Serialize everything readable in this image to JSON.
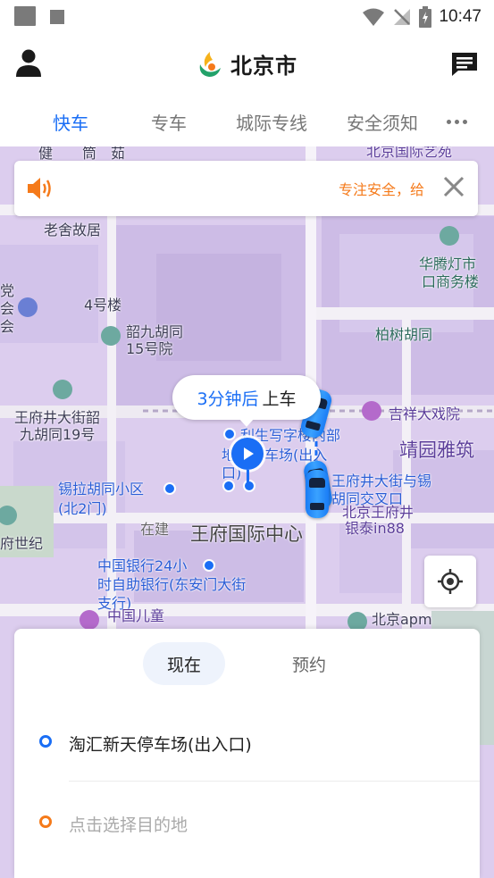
{
  "status_bar": {
    "time": "10:47"
  },
  "header": {
    "city": "北京市"
  },
  "tabs": [
    {
      "label": "快车",
      "active": true
    },
    {
      "label": "专车"
    },
    {
      "label": "城际专线"
    },
    {
      "label": "安全须知"
    }
  ],
  "notice": {
    "text": "专注安全，给"
  },
  "map": {
    "pickup_eta": "3分钟后",
    "pickup_label": "上车",
    "pois": {
      "p1": "健",
      "p2": "筒",
      "p3": "茹",
      "p4": "北京国际艺苑",
      "p5": "老舍故居",
      "p6": "华腾灯市",
      "p7": "口商务楼",
      "p8": "4号楼",
      "p9": "韶九胡同",
      "p10": "15号院",
      "p11": "柏树胡同",
      "p12": "王府井大街韶",
      "p13": "九胡同19号",
      "p14": "吉祥大戏院",
      "p15": "靖园雅筑",
      "p16": "利生写字楼内部",
      "p17": "地上停车场(出入",
      "p18": "口)",
      "p19": "锡拉胡同小区",
      "p20": "(北2门)",
      "p21": "王府井大街与锡",
      "p22": "胡同交叉口",
      "p23": "北京王府井",
      "p24": "银泰in88",
      "p25": "在建",
      "p26": "王府国际中心",
      "p27": "中国银行24小",
      "p28": "时自助银行(东安门大街",
      "p29": "支行)",
      "p30": "北京apm",
      "p31": "中国儿童",
      "p32": "府世纪",
      "p33": "党",
      "p34": "会",
      "p35": "会"
    }
  },
  "trip": {
    "mode_now": "现在",
    "mode_later": "预约",
    "origin": "淘汇新天停车场(出入口)",
    "destination_placeholder": "点击选择目的地"
  },
  "colors": {
    "accent": "#1a6ef5",
    "orange": "#f57a1a",
    "map_bg": "#d9cbec"
  }
}
